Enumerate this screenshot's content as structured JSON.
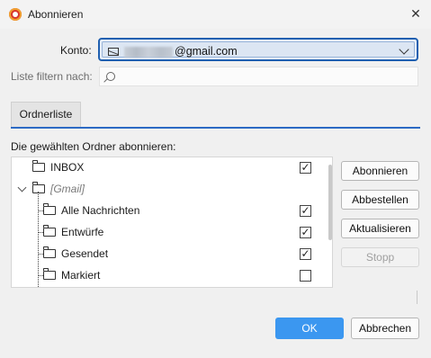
{
  "window": {
    "title": "Abonnieren",
    "close_glyph": "✕"
  },
  "account": {
    "label": "Konto:",
    "email_visible": "@gmail.com",
    "icon": "envelope-icon"
  },
  "filter": {
    "label": "Liste filtern nach:",
    "value": "",
    "icon": "search-icon"
  },
  "tabs": [
    {
      "label": "Ordnerliste",
      "active": true
    }
  ],
  "section_label": "Die gewählten Ordner abonnieren:",
  "folders": [
    {
      "name": "INBOX",
      "checked": true,
      "level": 0
    },
    {
      "name": "[Gmail]",
      "checked": null,
      "level": 0,
      "expanded": true,
      "italic": true
    },
    {
      "name": "Alle Nachrichten",
      "checked": true,
      "level": 1
    },
    {
      "name": "Entwürfe",
      "checked": true,
      "level": 1
    },
    {
      "name": "Gesendet",
      "checked": true,
      "level": 1
    },
    {
      "name": "Markiert",
      "checked": false,
      "level": 1
    }
  ],
  "actions": {
    "subscribe": "Abonnieren",
    "unsubscribe": "Abbestellen",
    "refresh": "Aktualisieren",
    "stop": "Stopp"
  },
  "footer": {
    "ok": "OK",
    "cancel": "Abbrechen"
  },
  "colors": {
    "accent": "#2c6ac4",
    "ok_button": "#3b97f0",
    "focus_border": "#1f5fb0"
  }
}
